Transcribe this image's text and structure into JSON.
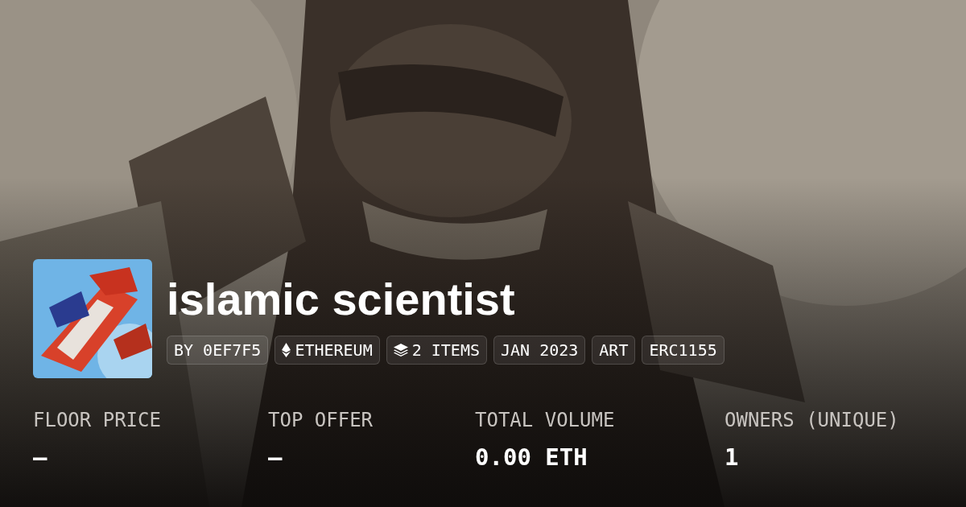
{
  "collection": {
    "title": "islamic scientist",
    "tags": [
      {
        "kind": "plain",
        "label": "BY 0EF7F5"
      },
      {
        "kind": "chain",
        "label": "ETHEREUM"
      },
      {
        "kind": "count",
        "label": "2 ITEMS"
      },
      {
        "kind": "plain",
        "label": "JAN 2023"
      },
      {
        "kind": "plain",
        "label": "ART"
      },
      {
        "kind": "plain",
        "label": "ERC1155"
      }
    ]
  },
  "stats": [
    {
      "label": "FLOOR PRICE",
      "value": "–"
    },
    {
      "label": "TOP OFFER",
      "value": "–"
    },
    {
      "label": "TOTAL VOLUME",
      "value": "0.00 ETH"
    },
    {
      "label": "OWNERS (UNIQUE)",
      "value": "1"
    }
  ]
}
